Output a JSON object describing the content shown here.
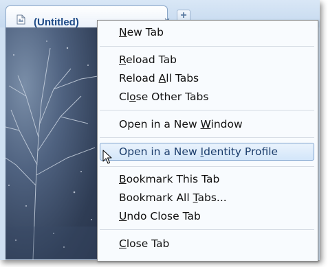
{
  "tab": {
    "title": "(Untitled)",
    "close_glyph": "×",
    "new_tab_glyph": "+",
    "icon": "page-icon"
  },
  "menu": {
    "items": [
      {
        "pre": "",
        "key": "N",
        "post": "ew Tab"
      },
      {
        "pre": "",
        "key": "R",
        "post": "eload Tab"
      },
      {
        "pre": "Reload ",
        "key": "A",
        "post": "ll Tabs"
      },
      {
        "pre": "Cl",
        "key": "o",
        "post": "se Other Tabs"
      },
      {
        "pre": "Open in a New ",
        "key": "W",
        "post": "indow"
      },
      {
        "pre": "Open in a New ",
        "key": "I",
        "post": "dentity Profile"
      },
      {
        "pre": "",
        "key": "B",
        "post": "ookmark This Tab"
      },
      {
        "pre": "Bookmark All ",
        "key": "T",
        "post": "abs..."
      },
      {
        "pre": "",
        "key": "U",
        "post": "ndo Close Tab"
      },
      {
        "pre": "",
        "key": "C",
        "post": "lose Tab"
      }
    ],
    "highlighted_index": 5
  },
  "colors": {
    "highlight_border": "#7da2ce",
    "tab_title": "#1d4a86"
  }
}
